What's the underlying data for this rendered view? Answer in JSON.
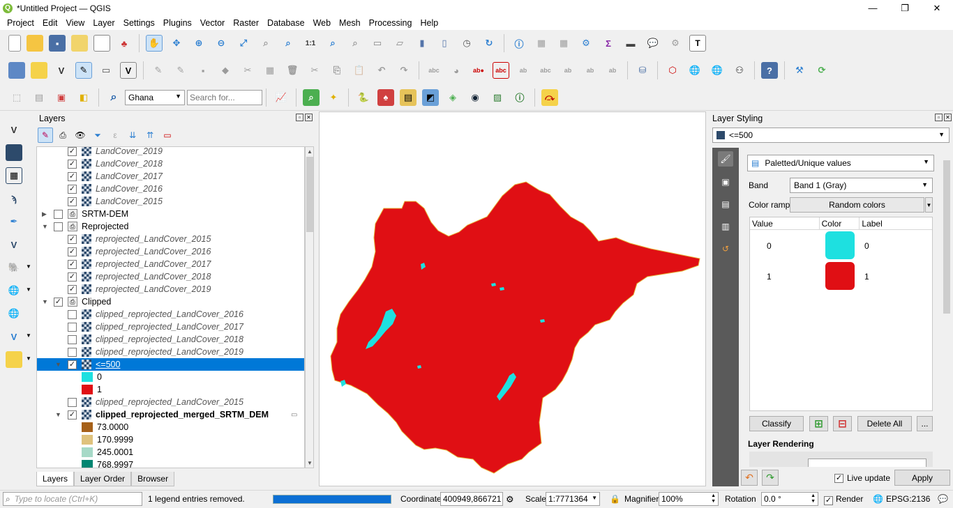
{
  "window": {
    "title": "*Untitled Project — QGIS",
    "min": "—",
    "max": "❐",
    "close": "✕"
  },
  "menu": [
    "Project",
    "Edit",
    "View",
    "Layer",
    "Settings",
    "Plugins",
    "Vector",
    "Raster",
    "Database",
    "Web",
    "Mesh",
    "Processing",
    "Help"
  ],
  "toolbar3": {
    "locator_combo": "Ghana",
    "search_placeholder": "Search for..."
  },
  "layers_panel": {
    "title": "Layers",
    "tree": [
      {
        "label": "LandCover_2019",
        "style": "italic",
        "checked": true,
        "type": "raster",
        "indent": 1
      },
      {
        "label": "LandCover_2018",
        "style": "italic",
        "checked": true,
        "type": "raster",
        "indent": 1
      },
      {
        "label": "LandCover_2017",
        "style": "italic",
        "checked": true,
        "type": "raster",
        "indent": 1
      },
      {
        "label": "LandCover_2016",
        "style": "italic",
        "checked": true,
        "type": "raster",
        "indent": 1
      },
      {
        "label": "LandCover_2015",
        "style": "italic",
        "checked": true,
        "type": "raster",
        "indent": 1
      },
      {
        "label": "SRTM-DEM",
        "style": "normal",
        "checked": false,
        "type": "group",
        "indent": 0,
        "expander": "▶"
      },
      {
        "label": "Reprojected",
        "style": "normal",
        "checked": false,
        "type": "group",
        "indent": 0,
        "expander": "▼"
      },
      {
        "label": "reprojected_LandCover_2015",
        "style": "italic",
        "checked": true,
        "type": "raster",
        "indent": 1
      },
      {
        "label": "reprojected_LandCover_2016",
        "style": "italic",
        "checked": true,
        "type": "raster",
        "indent": 1
      },
      {
        "label": "reprojected_LandCover_2017",
        "style": "italic",
        "checked": true,
        "type": "raster",
        "indent": 1
      },
      {
        "label": "reprojected_LandCover_2018",
        "style": "italic",
        "checked": true,
        "type": "raster",
        "indent": 1
      },
      {
        "label": "reprojected_LandCover_2019",
        "style": "italic",
        "checked": true,
        "type": "raster",
        "indent": 1
      },
      {
        "label": "Clipped",
        "style": "normal",
        "checked": true,
        "type": "group",
        "indent": 0,
        "expander": "▼"
      },
      {
        "label": "clipped_reprojected_LandCover_2016",
        "style": "italic",
        "checked": false,
        "type": "raster",
        "indent": 1
      },
      {
        "label": "clipped_reprojected_LandCover_2017",
        "style": "italic",
        "checked": false,
        "type": "raster",
        "indent": 1
      },
      {
        "label": "clipped_reprojected_LandCover_2018",
        "style": "italic",
        "checked": false,
        "type": "raster",
        "indent": 1
      },
      {
        "label": "clipped_reprojected_LandCover_2019",
        "style": "italic",
        "checked": false,
        "type": "raster",
        "indent": 1
      },
      {
        "label": "<=500",
        "style": "selected",
        "checked": true,
        "type": "raster",
        "indent": 1,
        "expander": "▼"
      },
      {
        "label": "0",
        "style": "legend",
        "color": "#1ee0e0",
        "indent": 2
      },
      {
        "label": "1",
        "style": "legend",
        "color": "#e00f14",
        "indent": 2
      },
      {
        "label": "clipped_reprojected_LandCover_2015",
        "style": "italic",
        "checked": false,
        "type": "raster",
        "indent": 1
      },
      {
        "label": "clipped_reprojected_merged_SRTM_DEM",
        "style": "bold",
        "checked": true,
        "type": "raster",
        "indent": 1,
        "expander": "▼"
      },
      {
        "label": "73.0000",
        "style": "legend",
        "color": "#a6611a",
        "indent": 2
      },
      {
        "label": "170.9999",
        "style": "legend",
        "color": "#dfc27d",
        "indent": 2
      },
      {
        "label": "245.0001",
        "style": "legend",
        "color": "#a6d9c7",
        "indent": 2
      },
      {
        "label": "768.9997",
        "style": "legend",
        "color": "#018571",
        "indent": 2
      }
    ],
    "tabs": [
      "Layers",
      "Layer Order",
      "Browser"
    ]
  },
  "styling": {
    "title": "Layer Styling",
    "layer_combo": "<=500",
    "renderer": "Paletted/Unique values",
    "band_label": "Band",
    "band_value": "Band 1 (Gray)",
    "ramp_label": "Color ramp",
    "ramp_value": "Random colors",
    "table_headers": [
      "Value",
      "Color",
      "Label"
    ],
    "rows": [
      {
        "value": "0",
        "color": "#1ee0e0",
        "label": "0"
      },
      {
        "value": "1",
        "color": "#e00f14",
        "label": "1"
      }
    ],
    "classify": "Classify",
    "delete_all": "Delete All",
    "more": "...",
    "rendering_title": "Layer Rendering",
    "live_update": "Live update",
    "apply": "Apply"
  },
  "map": {
    "land_color": "#e00f14",
    "water_color": "#1ee0e0"
  },
  "status": {
    "locate_placeholder": "Type to locate (Ctrl+K)",
    "message": "1 legend entries removed.",
    "coordinate_label": "Coordinate",
    "coordinate": "400949,866721",
    "scale_label": "Scale",
    "scale": "1:7771364",
    "magnifier_label": "Magnifier",
    "magnifier": "100%",
    "rotation_label": "Rotation",
    "rotation": "0.0 °",
    "render_label": "Render",
    "crs": "EPSG:2136"
  }
}
